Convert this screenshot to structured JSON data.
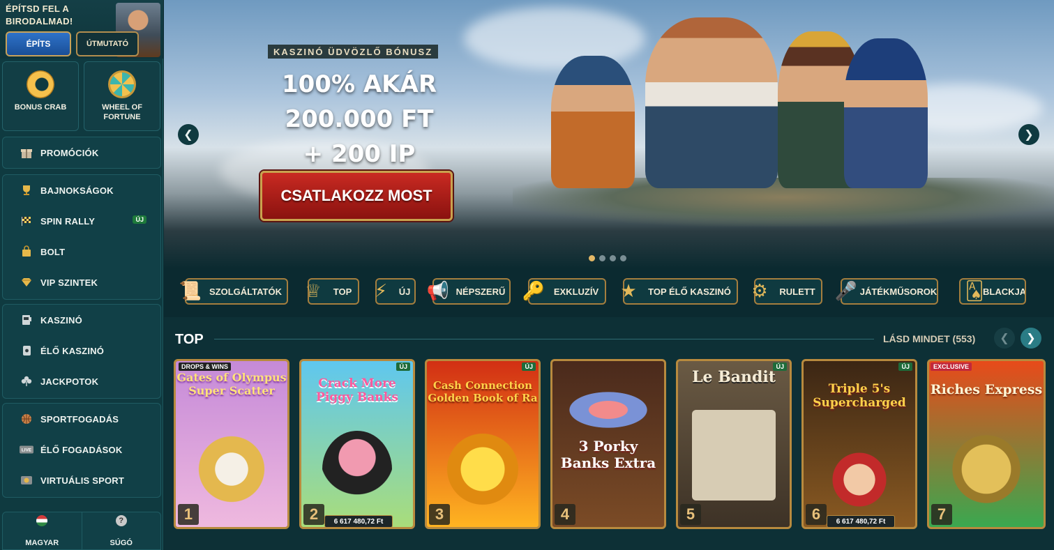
{
  "sidebar": {
    "build_title": "ÉPÍTSD FEL A BIRODALMAD!",
    "build_button": "ÉPÍTS",
    "guide_button": "ÚTMUTATÓ",
    "tiles": [
      {
        "label": "BONUS CRAB",
        "icon": "crab-coin-icon"
      },
      {
        "label": "WHEEL OF FORTUNE",
        "icon": "wheel-icon"
      }
    ],
    "menu": [
      [
        {
          "label": "PROMÓCIÓK",
          "icon": "gift-icon"
        }
      ],
      [
        {
          "label": "BAJNOKSÁGOK",
          "icon": "trophy-icon"
        },
        {
          "label": "SPIN RALLY",
          "icon": "rally-flag-icon",
          "badge": "ÚJ"
        },
        {
          "label": "BOLT",
          "icon": "shopping-bag-icon"
        },
        {
          "label": "VIP SZINTEK",
          "icon": "diamond-icon"
        }
      ],
      [
        {
          "label": "KASZINÓ",
          "icon": "slot-machine-icon"
        },
        {
          "label": "ÉLŐ KASZINÓ",
          "icon": "playing-card-icon"
        },
        {
          "label": "JACKPOTOK",
          "icon": "clover-icon"
        }
      ],
      [
        {
          "label": "SPORTFOGADÁS",
          "icon": "basketball-icon"
        },
        {
          "label": "ÉLŐ FOGADÁSOK",
          "icon": "live-icon"
        },
        {
          "label": "VIRTUÁLIS SPORT",
          "icon": "virtual-sport-icon"
        }
      ]
    ],
    "language": "MAGYAR",
    "help": "SÚGÓ",
    "live_icon_text": "LIVE",
    "help_icon_text": "?"
  },
  "hero": {
    "tag": "KASZINÓ ÜDVÖZLŐ BÓNUSZ",
    "headline_line1": "100% AKÁR",
    "headline_line2": "200.000 FT",
    "headline_line3": "+ 200 IP",
    "cta": "CSATLAKOZZ MOST",
    "slides": 4,
    "active_slide": 1
  },
  "categories": [
    {
      "label": "SZOLGÁLTATÓK",
      "icon": "scroll-icon"
    },
    {
      "label": "TOP",
      "icon": "crown-icon"
    },
    {
      "label": "ÚJ",
      "icon": "lightning-icon"
    },
    {
      "label": "NÉPSZERŰ",
      "icon": "horn-icon"
    },
    {
      "label": "EXKLUZÍV",
      "icon": "key-icon"
    },
    {
      "label": "TOP ÉLŐ KASZINÓ",
      "icon": "star-icon"
    },
    {
      "label": "RULETT",
      "icon": "roulette-icon"
    },
    {
      "label": "JÁTÉKMŰSOROK",
      "icon": "microphone-icon"
    },
    {
      "label": "BLACKJA",
      "icon": "cards-icon"
    }
  ],
  "section": {
    "title": "TOP",
    "see_all": "LÁSD MINDET (553)"
  },
  "games": [
    {
      "rank": "1",
      "title": "Gates of Olympus Super Scatter",
      "badge": "DROPS & WINS",
      "colors": [
        "#c58ad8",
        "#efb9df"
      ]
    },
    {
      "rank": "2",
      "title": "Crack More Piggy Banks",
      "new": "ÚJ",
      "jackpot": "6 617 480,72 Ft",
      "colors": [
        "#5fc7ef",
        "#a9dd7a"
      ]
    },
    {
      "rank": "3",
      "title": "Cash Connection Golden Book of Ra",
      "new": "ÚJ",
      "colors": [
        "#d22f14",
        "#ffb421"
      ]
    },
    {
      "rank": "4",
      "title": "3 Porky Banks Extra",
      "colors": [
        "#4a2a1c",
        "#7b4b26"
      ]
    },
    {
      "rank": "5",
      "title": "Le Bandit",
      "new": "ÚJ",
      "colors": [
        "#6a5a44",
        "#3d3226"
      ]
    },
    {
      "rank": "6",
      "title": "Triple 5's Supercharged",
      "new": "ÚJ",
      "jackpot": "6 617 480,72 Ft",
      "colors": [
        "#3b2614",
        "#8a5a22"
      ]
    },
    {
      "rank": "7",
      "title": "Riches Express",
      "badge": "EXCLUSIVE",
      "colors": [
        "#e84a1a",
        "#3aa850"
      ]
    }
  ]
}
